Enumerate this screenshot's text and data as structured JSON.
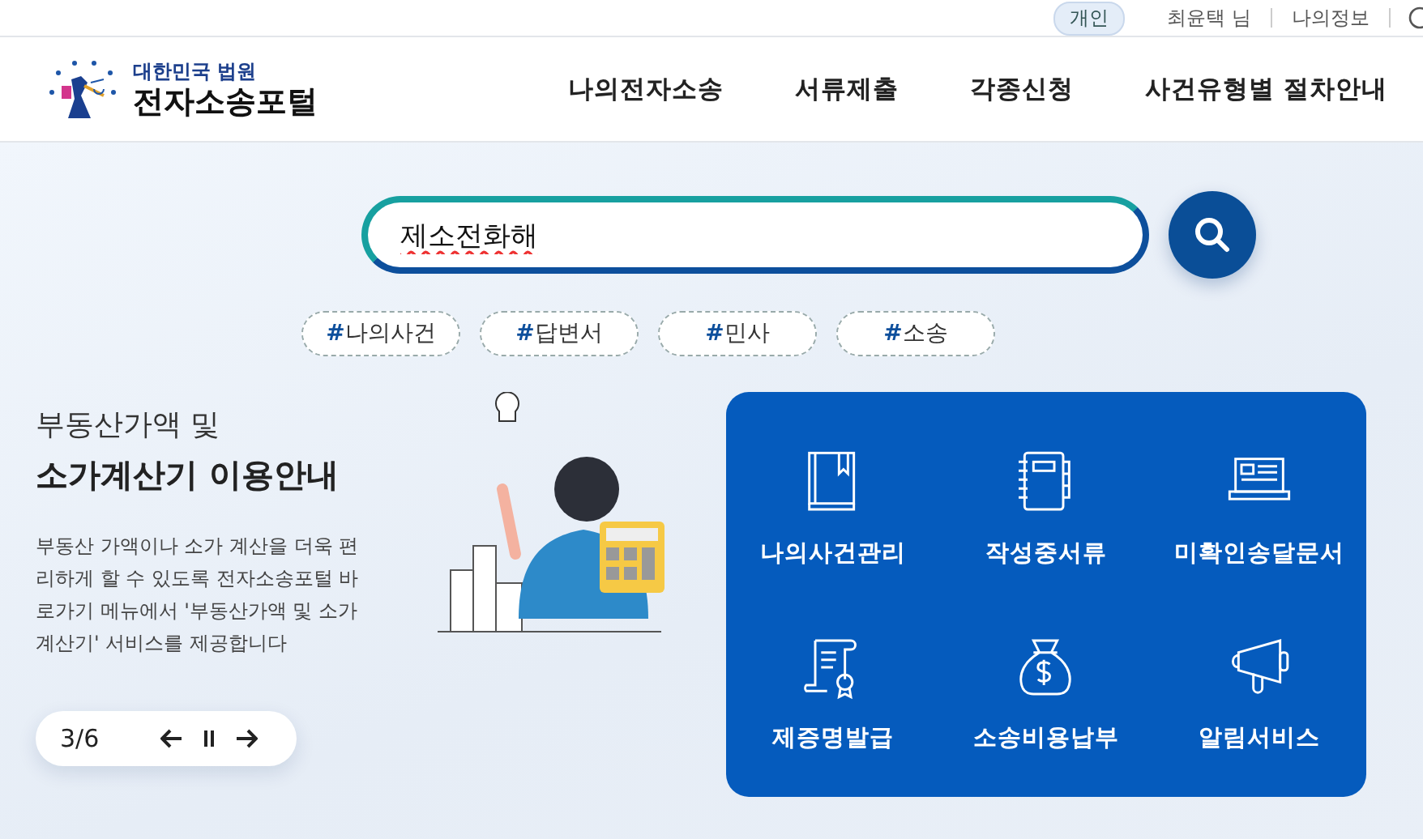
{
  "top_bar": {
    "user_type": "개인",
    "user_name": "최윤택 님",
    "my_info": "나의정보"
  },
  "header": {
    "logo_subtitle": "대한민국 법원",
    "logo_title": "전자소송포털",
    "nav": [
      "나의전자소송",
      "서류제출",
      "각종신청",
      "사건유형별 절차안내"
    ]
  },
  "search": {
    "value": "제소전화해"
  },
  "tags": [
    {
      "mark": "#",
      "label": "나의사건"
    },
    {
      "mark": "#",
      "label": "답변서"
    },
    {
      "mark": "#",
      "label": "민사"
    },
    {
      "mark": "#",
      "label": "소송"
    }
  ],
  "banner": {
    "title_line_1": "부동산가액 및",
    "title_line_2": "소가계산기 이용안내",
    "body": "부동산 가액이나 소가 계산을 더욱 편리하게 할 수 있도록 전자소송포털 바로가기 메뉴에서 '부동산가액 및 소가계산기' 서비스를 제공합니다",
    "pager": "3/6"
  },
  "quick_menu": [
    {
      "kind": "book",
      "label": "나의사건관리"
    },
    {
      "kind": "notebook",
      "label": "작성중서류"
    },
    {
      "kind": "laptop",
      "label": "미확인송달문서"
    },
    {
      "kind": "certificate",
      "label": "제증명발급"
    },
    {
      "kind": "moneybag",
      "label": "소송비용납부"
    },
    {
      "kind": "megaphone",
      "label": "알림서비스"
    }
  ]
}
